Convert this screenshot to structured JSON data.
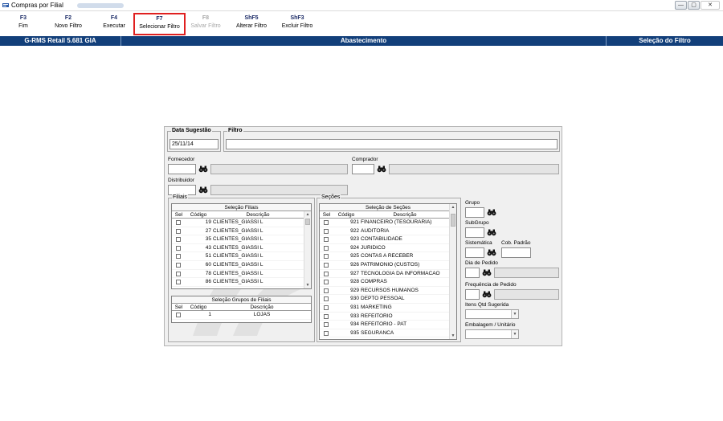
{
  "window": {
    "title": "Compras por Filial",
    "buttons": {
      "minimize": "—",
      "maximize": "▢",
      "close": "✕"
    }
  },
  "toolbar": {
    "keys": [
      {
        "key": "F3",
        "label": "Fim"
      },
      {
        "key": "F2",
        "label": "Novo Filtro"
      },
      {
        "key": "F4",
        "label": "Executar"
      },
      {
        "key": "F7",
        "label": "Selecionar Filtro"
      },
      {
        "key": "F8",
        "label": "Salvar Filtro"
      },
      {
        "key": "ShF5",
        "label": "Alterar Filtro"
      },
      {
        "key": "ShF3",
        "label": "Excluir Filtro"
      }
    ]
  },
  "status": {
    "app": "G-RMS Retail 5.681 GIA",
    "module": "Abastecimento",
    "screen": "Seleção do Filtro"
  },
  "form": {
    "data_sugestao_label": "Data Sugestão",
    "data_sugestao_value": "25/11/14",
    "filtro_label": "Filtro",
    "filtro_value": "",
    "fornecedor_label": "Fornecedor",
    "comprador_label": "Comprador",
    "distribuidor_label": "Distribuidor",
    "filiais_label": "Filiais",
    "secoes_label": "Seções",
    "grupo_label": "Grupo",
    "subgrupo_label": "SubGrupo",
    "sistematica_label": "Sistemática",
    "cob_padrao_label": "Cob. Padrão",
    "dia_pedido_label": "Dia de Pedido",
    "freq_pedido_label": "Frequência de Pedido",
    "itens_qtd_label": "Itens Qtd Sugerida",
    "embalagem_label": "Embalagem / Unitário"
  },
  "filiais_table": {
    "title": "Seleção Filiais",
    "columns": [
      "Sel",
      "Código",
      "Descrição"
    ],
    "rows": [
      {
        "code": "19",
        "desc": "CLIENTES_GIASSI L"
      },
      {
        "code": "27",
        "desc": "CLIENTES_GIASSI L"
      },
      {
        "code": "35",
        "desc": "CLIENTES_GIASSI L"
      },
      {
        "code": "43",
        "desc": "CLIENTES_GIASSI L"
      },
      {
        "code": "51",
        "desc": "CLIENTES_GIASSI L"
      },
      {
        "code": "60",
        "desc": "CLIENTES_GIASSI L"
      },
      {
        "code": "78",
        "desc": "CLIENTES_GIASSI L"
      },
      {
        "code": "86",
        "desc": "CLIENTES_GIASSI L"
      }
    ]
  },
  "grupos_table": {
    "title": "Seleção Grupos de Filiais",
    "columns": [
      "Sel",
      "Código",
      "Descrição"
    ],
    "rows": [
      {
        "code": "1",
        "desc": "LOJAS"
      }
    ]
  },
  "secoes_table": {
    "title": "Seleção de Seções",
    "columns": [
      "Sel",
      "Código",
      "Descrição"
    ],
    "rows": [
      {
        "code": "921",
        "desc": "FINANCEIRO (TESOURARIA)"
      },
      {
        "code": "922",
        "desc": "AUDITORIA"
      },
      {
        "code": "923",
        "desc": "CONTABILIDADE"
      },
      {
        "code": "924",
        "desc": "JURIDICO"
      },
      {
        "code": "925",
        "desc": "CONTAS A RECEBER"
      },
      {
        "code": "926",
        "desc": "PATRIMONIO (CUSTOS)"
      },
      {
        "code": "927",
        "desc": "TECNOLOGIA DA INFORMACAO"
      },
      {
        "code": "928",
        "desc": "COMPRAS"
      },
      {
        "code": "929",
        "desc": "RECURSOS HUMANOS"
      },
      {
        "code": "930",
        "desc": "DEPTO PESSOAL"
      },
      {
        "code": "931",
        "desc": "MARKETING"
      },
      {
        "code": "933",
        "desc": "REFEITORIO"
      },
      {
        "code": "934",
        "desc": "REFEITORIO - PAT"
      },
      {
        "code": "935",
        "desc": "SEGURANCA"
      }
    ]
  },
  "colors": {
    "status_bar": "#123f7a",
    "highlight": "#e02020",
    "key_text": "#1a2a66"
  }
}
